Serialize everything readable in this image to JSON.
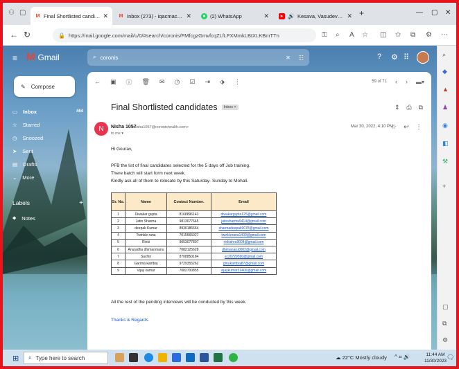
{
  "browser": {
    "tabs": [
      {
        "label": "Final Shortlisted candidates - mail",
        "icon": "gmail-icon",
        "active": true
      },
      {
        "label": "Inbox (273) - iqacmac@gmail.co",
        "icon": "gmail-icon",
        "active": false
      },
      {
        "label": "(2) WhatsApp",
        "icon": "whatsapp-icon",
        "active": false
      },
      {
        "label": "Kesava, Vasudeva & Ananta",
        "icon": "youtube-icon",
        "active": false
      }
    ],
    "new_tab": "+",
    "url": "https://mail.google.com/mail/u/0/#search/coronis/FMfcgzGmvfcqZLfLFXMmkLBtXLKBmTTn",
    "url_host": "mail.google.com"
  },
  "gmail": {
    "logo_text": "Gmail",
    "search_value": "coronis",
    "compose_label": "Compose",
    "nav": [
      {
        "label": "Inbox",
        "count": "464"
      },
      {
        "label": "Starred",
        "count": ""
      },
      {
        "label": "Snoozed",
        "count": ""
      },
      {
        "label": "Sent",
        "count": ""
      },
      {
        "label": "Drafts",
        "count": ""
      },
      {
        "label": "More",
        "count": ""
      }
    ],
    "labels_header": "Labels",
    "labels": [
      {
        "label": "Notes"
      }
    ],
    "pager": "59 of 71"
  },
  "email": {
    "subject": "Final Shortlisted candidates",
    "chip": "Inbox ×",
    "sender_initial": "N",
    "sender_name": "Nisha 1057",
    "sender_email": "<nisha1057@coronishealth.com>",
    "to": "to me ▾",
    "date": "Mar 30, 2022, 4:10 PM",
    "greeting": "Hi Gourav,",
    "line1": "PFB the list of final candidates selected for the 5 days off Job training.",
    "line2": "There batch will start form next week.",
    "line3": "Kindly ask all of them to relocate by this Saturday- Sunday to Mohali.",
    "closing": "All the rest of the pending interviews will be conducted by this week.",
    "signoff": "Thanks & Regards",
    "table": {
      "headers": [
        "Sr. No.",
        "Name",
        "Contact Number.",
        "Email"
      ],
      "rows": [
        [
          "1",
          "Diwakar gupta",
          "8168896143",
          "diwakargupta125@gmail.com"
        ],
        [
          "2",
          "Jatin Sharma",
          "9813077645",
          "jatinsharma9414@gmail.com"
        ],
        [
          "3",
          "deepak Kumar",
          "8930186664",
          "sharmadeepak9078@gmail.com"
        ],
        [
          "4",
          "Twinkle rana",
          "7015555027",
          "twinklerana1409@gmail.com"
        ],
        [
          "5",
          "Rinki",
          "9053077807",
          "rinkishra9004@gmail.com"
        ],
        [
          "6",
          "Anuradha dhimanmanu",
          "7082125628",
          "dhimanaru0002@gmail.com"
        ],
        [
          "7",
          "Sachin",
          "8708850184",
          "sc20729590@gmail.com"
        ],
        [
          "8",
          "Garima kamboj",
          "9729355262",
          "gmukamboj87@gmail.com"
        ],
        [
          "9",
          "Vijay kumar",
          "7082700855",
          "vijaykumar32400@gmail.com"
        ]
      ]
    }
  },
  "taskbar": {
    "search_placeholder": "Type here to search",
    "weather": "22°C  Mostly cloudy",
    "time": "11:44 AM",
    "date": "11/30/2023"
  },
  "colors": {
    "border": "#e8141c",
    "gmail_red": "#ea4335",
    "chip_bg": "#dddddd",
    "table_header": "#fce9c8",
    "link": "#1a57c7"
  }
}
